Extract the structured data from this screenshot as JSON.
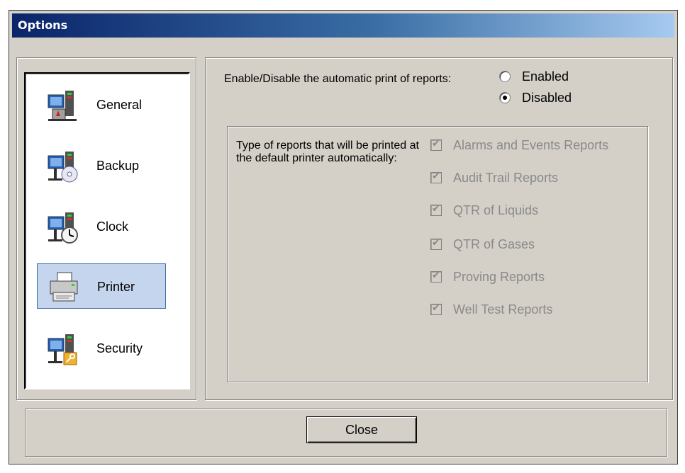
{
  "window": {
    "title": "Options"
  },
  "sidebar": {
    "items": [
      {
        "label": "General",
        "icon": "computer-settings-icon"
      },
      {
        "label": "Backup",
        "icon": "computer-disc-icon"
      },
      {
        "label": "Clock",
        "icon": "computer-clock-icon"
      },
      {
        "label": "Printer",
        "icon": "printer-icon",
        "selected": true
      },
      {
        "label": "Security",
        "icon": "computer-key-icon"
      }
    ]
  },
  "printer": {
    "prompt": "Enable/Disable the automatic print of reports:",
    "options": [
      "Enabled",
      "Disabled"
    ],
    "selected": "Disabled",
    "types_label": "Type of reports that will be printed at the default printer automatically:",
    "report_types": [
      {
        "label": "Alarms and Events Reports",
        "checked": true,
        "enabled": false
      },
      {
        "label": "Audit Trail Reports",
        "checked": true,
        "enabled": false
      },
      {
        "label": "QTR of Liquids",
        "checked": true,
        "enabled": false
      },
      {
        "label": "QTR of Gases",
        "checked": true,
        "enabled": false
      },
      {
        "label": "Proving Reports",
        "checked": true,
        "enabled": false
      },
      {
        "label": "Well Test Reports",
        "checked": true,
        "enabled": false
      }
    ]
  },
  "footer": {
    "close_label": "Close"
  },
  "colors": {
    "title_start": "#0a246a",
    "title_end": "#a6caf0",
    "face": "#d4d0c8",
    "selection": "#c5d5ee",
    "disabled_text": "#8a8a8a"
  }
}
